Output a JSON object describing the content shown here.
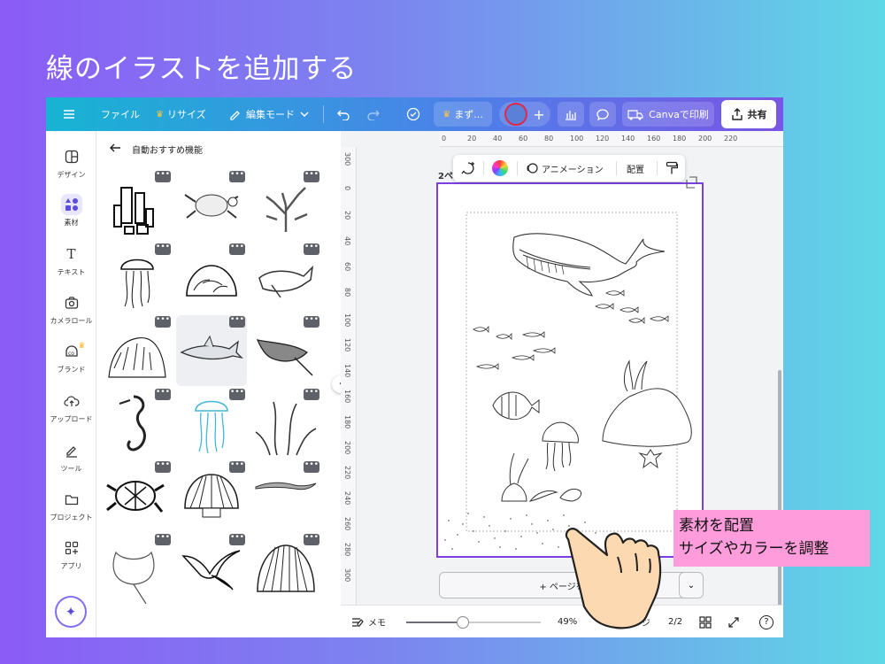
{
  "slide_title": "線のイラストを追加する",
  "topbar": {
    "menu_icon": "menu-icon",
    "file": "ファイル",
    "resize": "リサイズ",
    "edit_mode": "編集モード",
    "undo_icon": "undo-icon",
    "redo_icon": "redo-icon",
    "cloud_icon": "cloud-saved-icon",
    "draft": "まず...",
    "add_icon": "plus-icon",
    "chart_icon": "analytics-icon",
    "comment_icon": "comment-icon",
    "print": "Canvaで印刷",
    "share": "共有"
  },
  "rail": [
    {
      "label": "デザイン",
      "icon": "design-icon"
    },
    {
      "label": "素材",
      "icon": "elements-icon"
    },
    {
      "label": "テキスト",
      "icon": "text-icon"
    },
    {
      "label": "カメラロール",
      "icon": "camera-icon"
    },
    {
      "label": "ブランド",
      "icon": "brand-icon"
    },
    {
      "label": "アップロード",
      "icon": "upload-icon"
    },
    {
      "label": "ツール",
      "icon": "tools-icon"
    },
    {
      "label": "プロジェクト",
      "icon": "folder-icon"
    },
    {
      "label": "アプリ",
      "icon": "apps-icon"
    }
  ],
  "panel": {
    "back_icon": "arrow-left-icon",
    "title": "自動おすすめ機能",
    "more_label": "•••",
    "assets": [
      "sponge",
      "sea-turtle",
      "coral",
      "jellyfish",
      "coral-reef",
      "whale",
      "coral-bush",
      "shark",
      "manta-ray",
      "seahorse",
      "blue-jellyfish",
      "seaweed",
      "turtle",
      "scallop-shell",
      "eel",
      "stingray",
      "seagull",
      "seashell"
    ]
  },
  "ruler": {
    "top": [
      "0",
      "20",
      "40",
      "60",
      "80",
      "100",
      "120",
      "140",
      "160",
      "180",
      "200",
      "220"
    ],
    "left": [
      "300",
      "0",
      "20",
      "40",
      "60",
      "80",
      "100",
      "120",
      "140",
      "160",
      "180",
      "200",
      "220",
      "240",
      "260",
      "280",
      "300"
    ]
  },
  "canvas": {
    "page_label": "2ペ",
    "floatbar": {
      "animation": "アニメーション",
      "arrange": "配置"
    },
    "add_page": "+ ページを追加"
  },
  "bottombar": {
    "notes": "メモ",
    "zoom": "49%",
    "zoom_fraction": 0.42,
    "pages_label": "ページ",
    "page_count": "2/2",
    "help": "?"
  },
  "callout": {
    "line1": "素材を配置",
    "line2": "サイズやカラーを調整"
  }
}
